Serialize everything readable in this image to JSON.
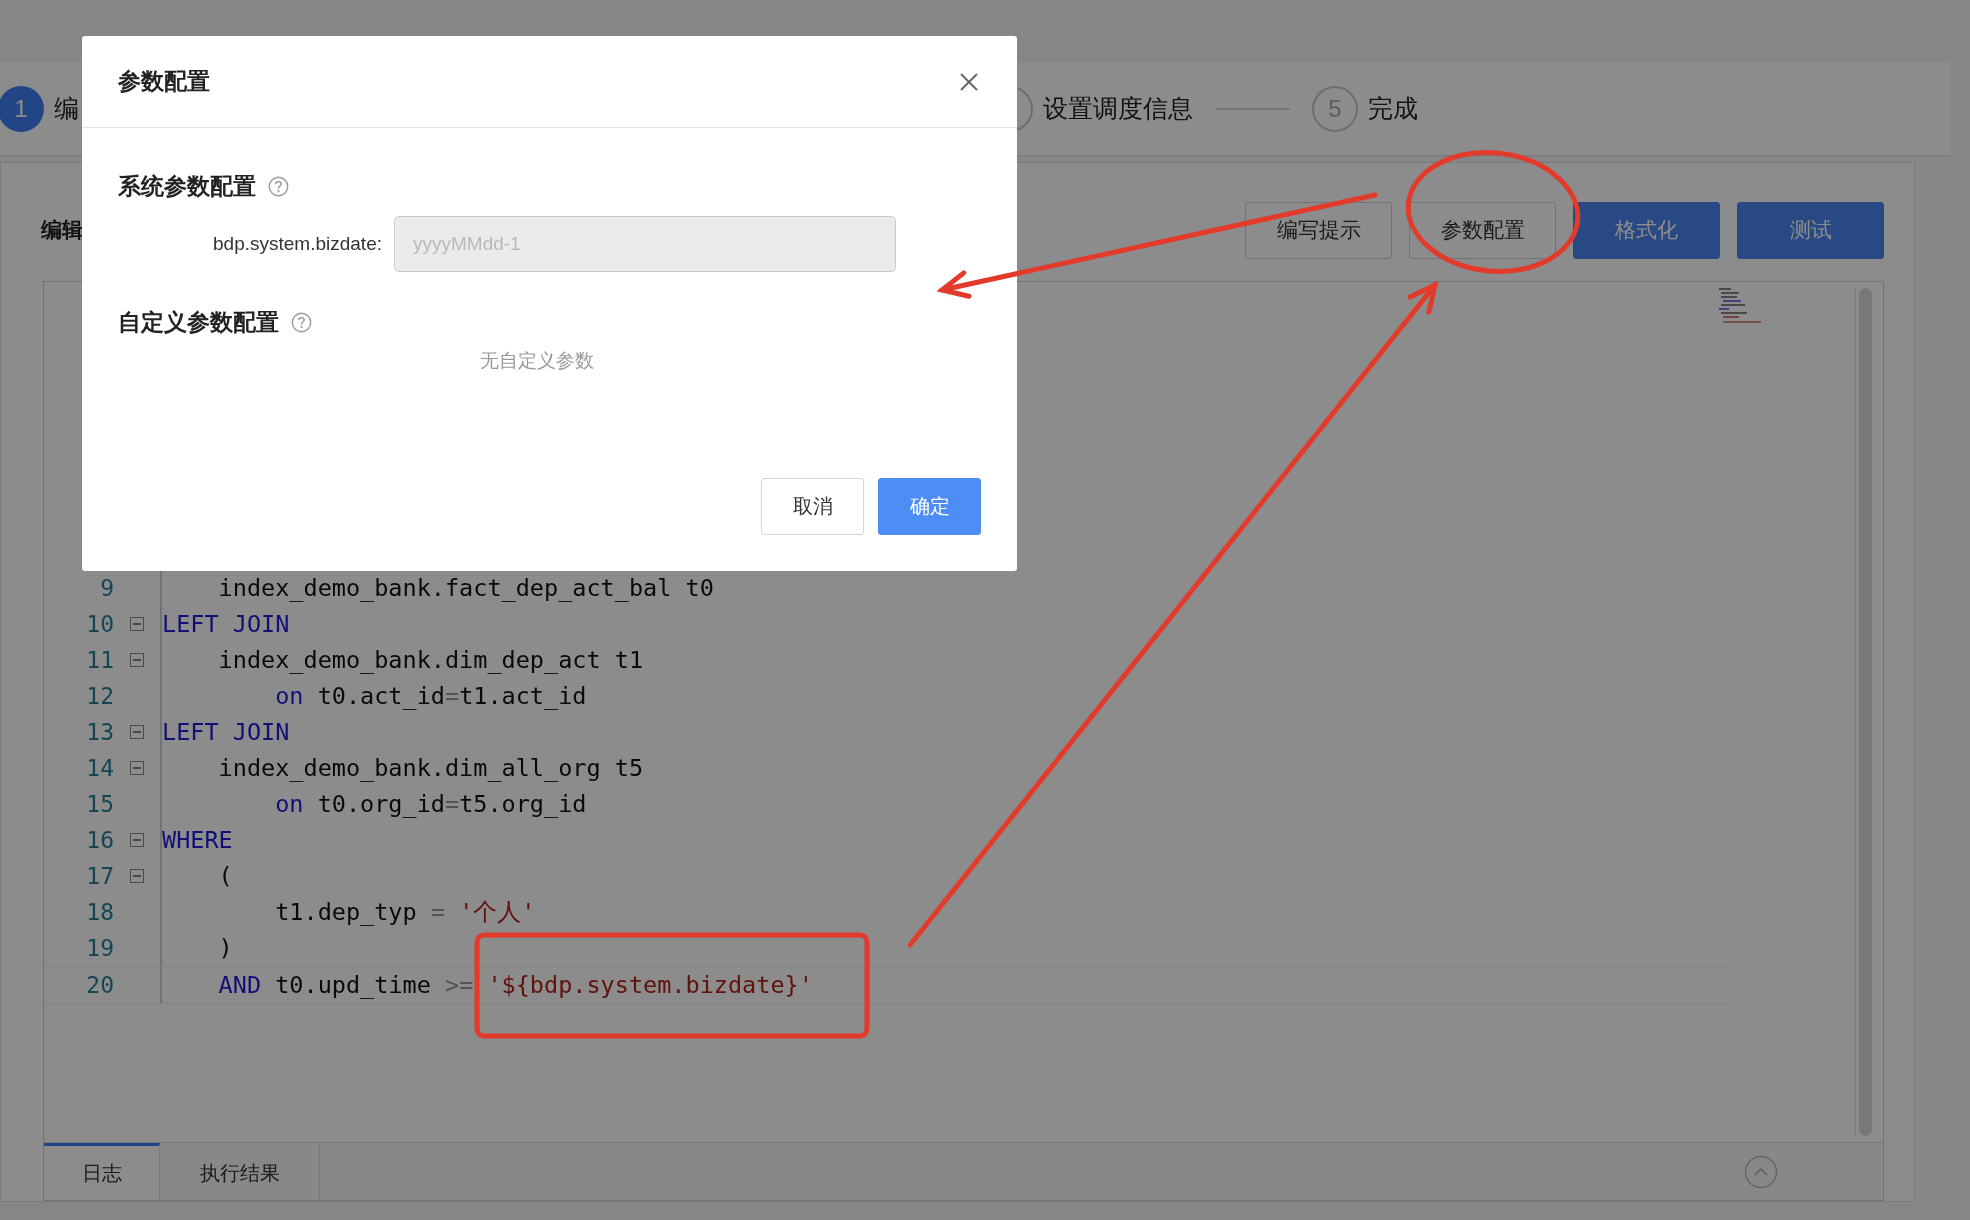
{
  "steps": [
    {
      "number": "1",
      "label": "编",
      "active": true
    },
    {
      "label": "设置调度信息",
      "active": false
    },
    {
      "number": "5",
      "label": "完成",
      "active": false
    }
  ],
  "editor_title": "编辑",
  "toolbar": [
    {
      "label": "编写提示",
      "kind": "default"
    },
    {
      "label": "参数配置",
      "kind": "default"
    },
    {
      "label": "格式化",
      "kind": "primary"
    },
    {
      "label": "测试",
      "kind": "primary"
    }
  ],
  "code_lines": [
    {
      "number": "9",
      "fold": false,
      "tokens": [
        {
          "text": "    index_demo_bank.fact_dep_act_bal t0",
          "kind": "plain"
        }
      ]
    },
    {
      "number": "10",
      "fold": true,
      "tokens": [
        {
          "text": "LEFT JOIN",
          "kind": "keyword"
        }
      ]
    },
    {
      "number": "11",
      "fold": true,
      "tokens": [
        {
          "text": "    index_demo_bank.dim_dep_act t1",
          "kind": "plain"
        }
      ]
    },
    {
      "number": "12",
      "fold": false,
      "tokens": [
        {
          "text": "        on",
          "kind": "keyword"
        },
        {
          "text": " t0.act_id",
          "kind": "plain"
        },
        {
          "text": "=",
          "kind": "operator"
        },
        {
          "text": "t1.act_id",
          "kind": "plain"
        }
      ]
    },
    {
      "number": "13",
      "fold": true,
      "tokens": [
        {
          "text": "LEFT JOIN",
          "kind": "keyword"
        }
      ]
    },
    {
      "number": "14",
      "fold": true,
      "tokens": [
        {
          "text": "    index_demo_bank.dim_all_org t5",
          "kind": "plain"
        }
      ]
    },
    {
      "number": "15",
      "fold": false,
      "tokens": [
        {
          "text": "        on",
          "kind": "keyword"
        },
        {
          "text": " t0.org_id",
          "kind": "plain"
        },
        {
          "text": "=",
          "kind": "operator"
        },
        {
          "text": "t5.org_id",
          "kind": "plain"
        }
      ]
    },
    {
      "number": "16",
      "fold": true,
      "tokens": [
        {
          "text": "WHERE",
          "kind": "keyword"
        }
      ]
    },
    {
      "number": "17",
      "fold": true,
      "tokens": [
        {
          "text": "    (",
          "kind": "plain"
        }
      ]
    },
    {
      "number": "18",
      "fold": false,
      "tokens": [
        {
          "text": "        t1.dep_typ ",
          "kind": "plain"
        },
        {
          "text": "=",
          "kind": "operator"
        },
        {
          "text": " '个人'",
          "kind": "string"
        }
      ]
    },
    {
      "number": "19",
      "fold": false,
      "tokens": [
        {
          "text": "    )",
          "kind": "plain"
        }
      ]
    },
    {
      "number": "20",
      "fold": false,
      "tokens": [
        {
          "text": "    AND",
          "kind": "keyword"
        },
        {
          "text": " t0.upd_time ",
          "kind": "plain"
        },
        {
          "text": ">=",
          "kind": "operator"
        },
        {
          "text": " '${bdp.system.bizdate}'",
          "kind": "string"
        }
      ]
    }
  ],
  "bottom_tabs": [
    {
      "label": "日志",
      "selected": true
    },
    {
      "label": "执行结果",
      "selected": false
    }
  ],
  "modal": {
    "title": "参数配置",
    "sections": [
      {
        "title": "系统参数配置",
        "fields": [
          {
            "label": "bdp.system.bizdate:",
            "placeholder": "yyyyMMdd-1"
          }
        ]
      },
      {
        "title": "自定义参数配置",
        "empty_text": "无自定义参数"
      }
    ],
    "buttons": [
      {
        "label": "取消",
        "kind": "default"
      },
      {
        "label": "确定",
        "kind": "primary"
      }
    ]
  }
}
